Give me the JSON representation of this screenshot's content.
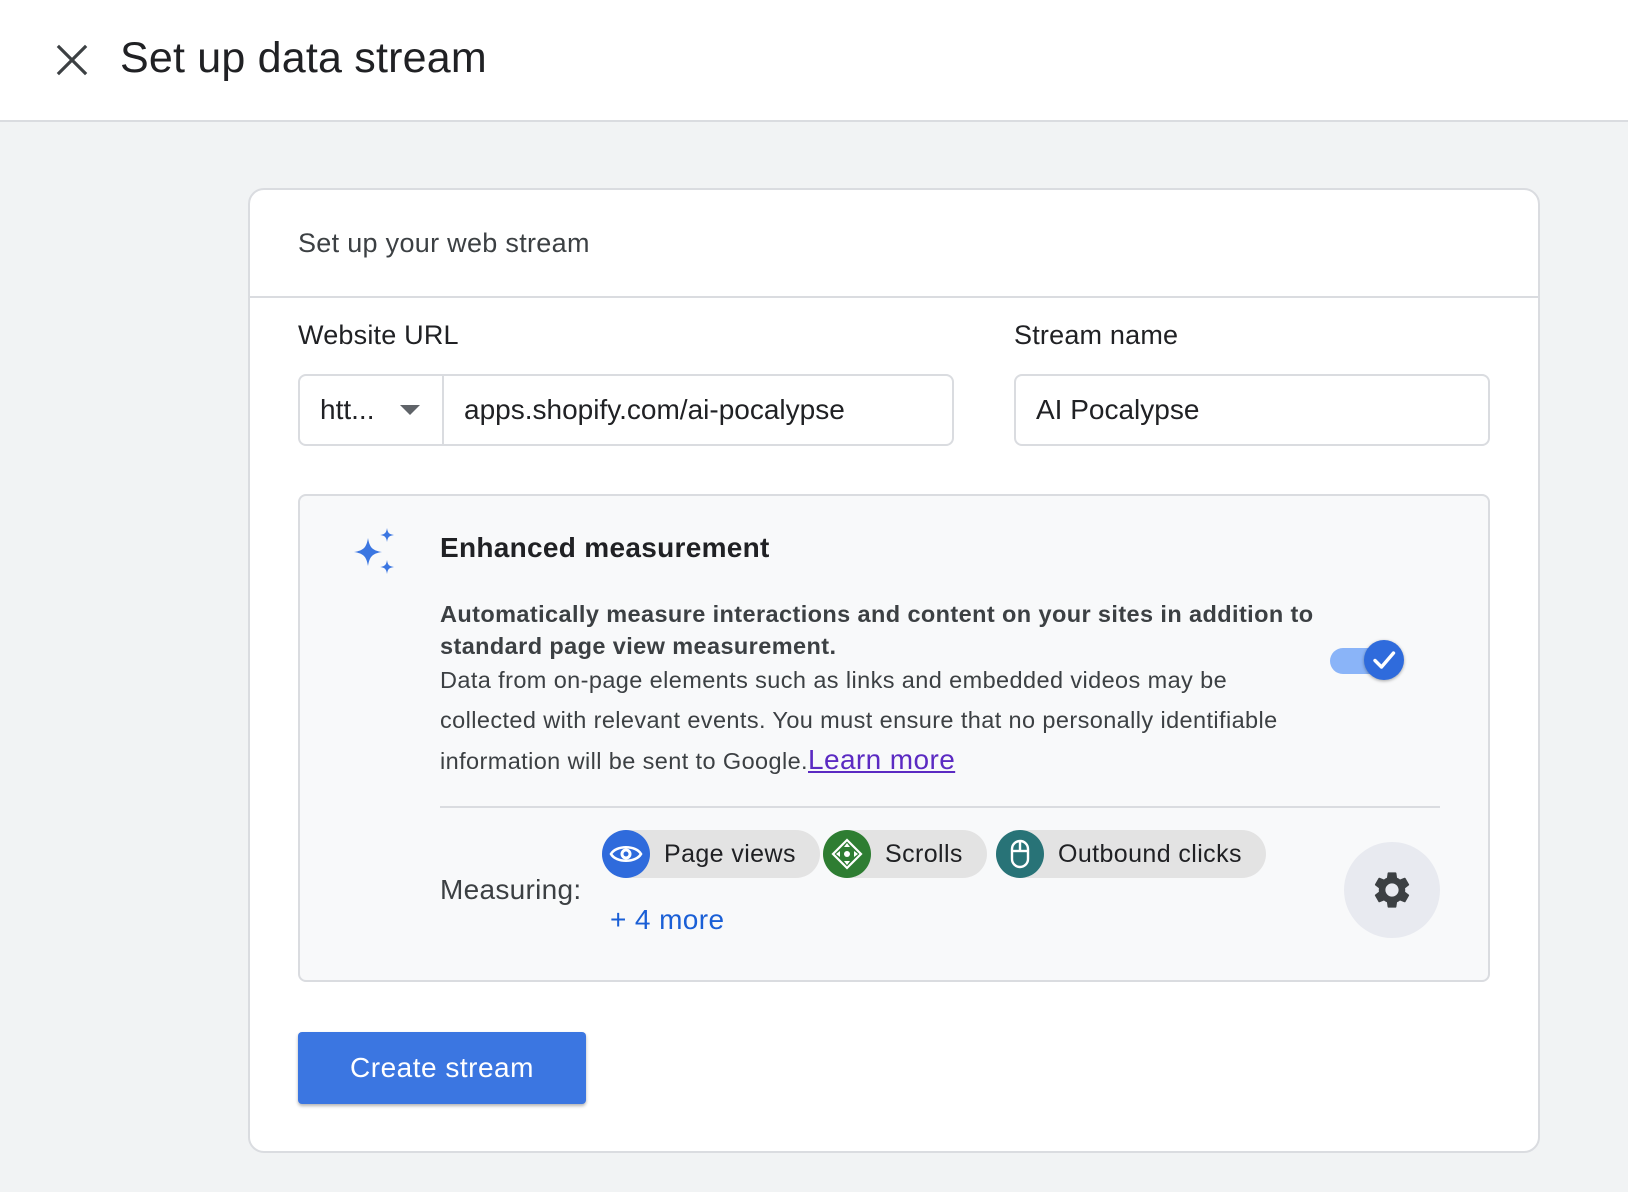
{
  "header": {
    "title": "Set up data stream",
    "close_icon": "close-icon"
  },
  "card": {
    "title": "Set up your web stream",
    "website_url": {
      "label": "Website URL",
      "protocol": "htt...",
      "value": "apps.shopify.com/ai-pocalypse"
    },
    "stream_name": {
      "label": "Stream name",
      "value": "AI Pocalypse"
    },
    "enhanced_measurement": {
      "icon": "sparkle-icon",
      "title": "Enhanced measurement",
      "bold_text": "Automatically measure interactions and content on your sites in addition to standard page view measurement.",
      "body_text": "Data from on-page elements such as links and embedded videos may be collected with relevant events. You must ensure that no personally identifiable information will be sent to Google.",
      "learn_more": "Learn more",
      "enabled": true,
      "measuring_label": "Measuring:",
      "chips": [
        {
          "label": "Page views",
          "icon": "eye-icon",
          "color": "#2f6bdc"
        },
        {
          "label": "Scrolls",
          "icon": "scroll-icon",
          "color": "#2e7d32"
        },
        {
          "label": "Outbound clicks",
          "icon": "mouse-icon",
          "color": "#287377"
        }
      ],
      "more": "+ 4 more",
      "settings_icon": "gear-icon"
    },
    "create_button": "Create stream"
  },
  "colors": {
    "primary": "#3b76e1",
    "toggle_on": "#2f6bdc",
    "link": "#5b2ac2"
  }
}
